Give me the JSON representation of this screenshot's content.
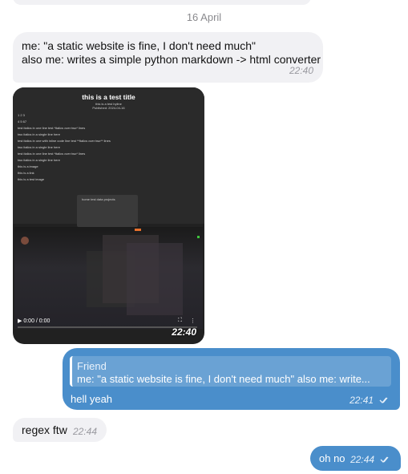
{
  "date_separator": "16 April",
  "messages": {
    "msg1": {
      "line1": "me: \"a static website is fine, I don't need much\"",
      "line2": "also me: writes a simple python markdown -> html converter",
      "time": "22:40"
    },
    "media": {
      "doc_title": "this is a test title",
      "doc_byline": "this is a test byline",
      "doc_published": "Published: 2024-04-16",
      "doc_lines": [
        "1 2 3",
        "4 5 67",
        "test italics in one line test *italics over two* lines",
        "two italics in a single line here",
        "test italics in one with inline code line test **italics over two** lines",
        "two italics in a single line here",
        "test italics in one line test *italics over two* lines",
        "two italics in a single line here",
        "this is a image",
        "this is a link",
        "this is a test image"
      ],
      "doc_path_label": "home  test  data  projects",
      "video_time_label": "0:00 / 0:00",
      "progress": 0.0,
      "time": "22:40"
    },
    "reply": {
      "quote_name": "Friend",
      "quote_text": "me: \"a static website is fine, I don't need much\" also me: write...",
      "body": "hell yeah",
      "time": "22:41"
    },
    "regex": {
      "body": "regex ftw",
      "time": "22:44"
    },
    "ohno": {
      "body": "oh no",
      "time": "22:44"
    }
  },
  "colors": {
    "incoming_bubble": "#f1f1f4",
    "outgoing_bubble": "#4a8ecb",
    "background": "#ffffff"
  },
  "icons": [
    "double-check-icon",
    "play-icon",
    "fullscreen-icon",
    "more-icon"
  ]
}
